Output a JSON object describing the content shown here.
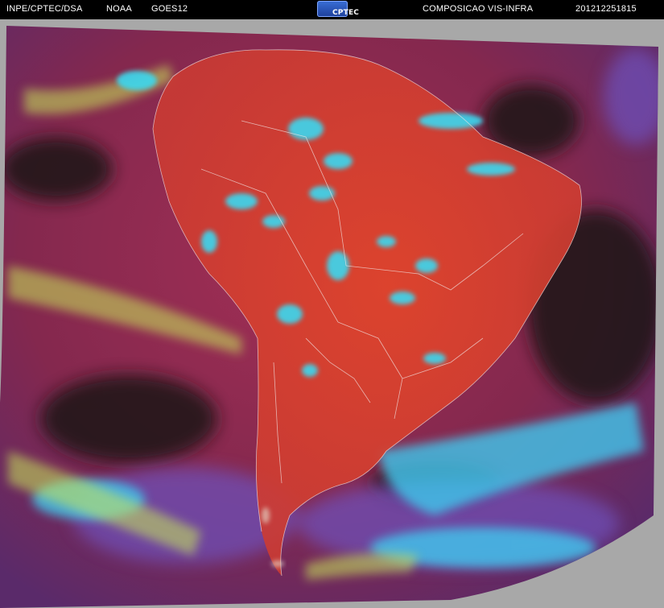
{
  "header": {
    "institution": "INPE/CPTEC/DSA",
    "agency": "NOAA",
    "satellite": "GOES12",
    "logo_text": "CPTEC",
    "product": "COMPOSICAO VIS-INFRA",
    "timestamp": "201212251815"
  },
  "image": {
    "subject": "false-color composite satellite view of South America",
    "colors": {
      "background": "#000000",
      "frame": "#a8a8a8",
      "ocean": "#8a2d52",
      "land": "#d8432a",
      "low_cloud": "#3ad8f0",
      "high_cloud": "#c8e85a",
      "clear_dark": "#1e1418"
    }
  }
}
